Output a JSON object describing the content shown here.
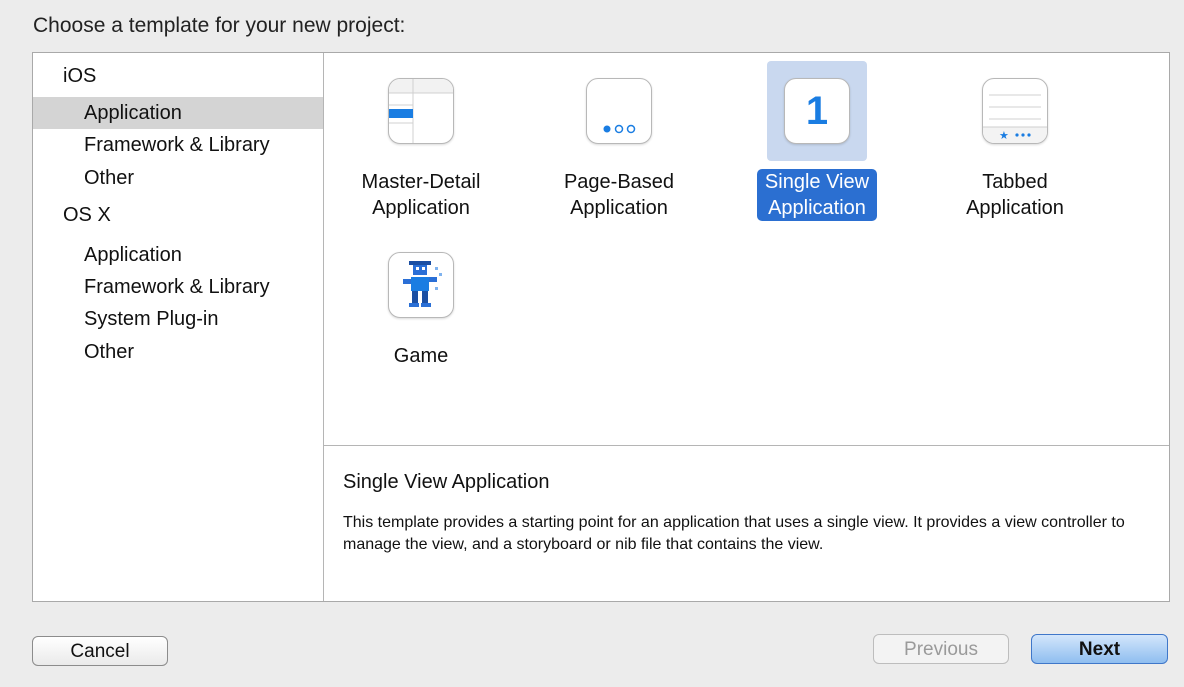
{
  "dialog": {
    "title": "Choose a template for your new project:"
  },
  "sidebar": {
    "groups": [
      {
        "label": "iOS",
        "items": [
          "Application",
          "Framework & Library",
          "Other"
        ]
      },
      {
        "label": "OS X",
        "items": [
          "Application",
          "Framework & Library",
          "System Plug-in",
          "Other"
        ]
      }
    ],
    "selected": "iOS / Application"
  },
  "templates": [
    {
      "line1": "Master-Detail",
      "line2": "Application",
      "icon": "master-detail-icon"
    },
    {
      "line1": "Page-Based",
      "line2": "Application",
      "icon": "page-based-icon"
    },
    {
      "line1": "Single View",
      "line2": "Application",
      "icon": "single-view-icon",
      "icon_text": "1",
      "selected": true
    },
    {
      "line1": "Tabbed",
      "line2": "Application",
      "icon": "tabbed-icon"
    },
    {
      "line1": "Game",
      "line2": "",
      "icon": "game-icon"
    }
  ],
  "description": {
    "title": "Single View Application",
    "body": "This template provides a starting point for an application that uses a single view. It provides a view controller to manage the view, and a storyboard or nib file that contains the view."
  },
  "buttons": {
    "cancel": "Cancel",
    "previous": "Previous",
    "next": "Next"
  },
  "colors": {
    "accent": "#2b6fd1",
    "selection_bg": "#c9d8ef",
    "sidebar_selected": "#d4d4d4"
  }
}
